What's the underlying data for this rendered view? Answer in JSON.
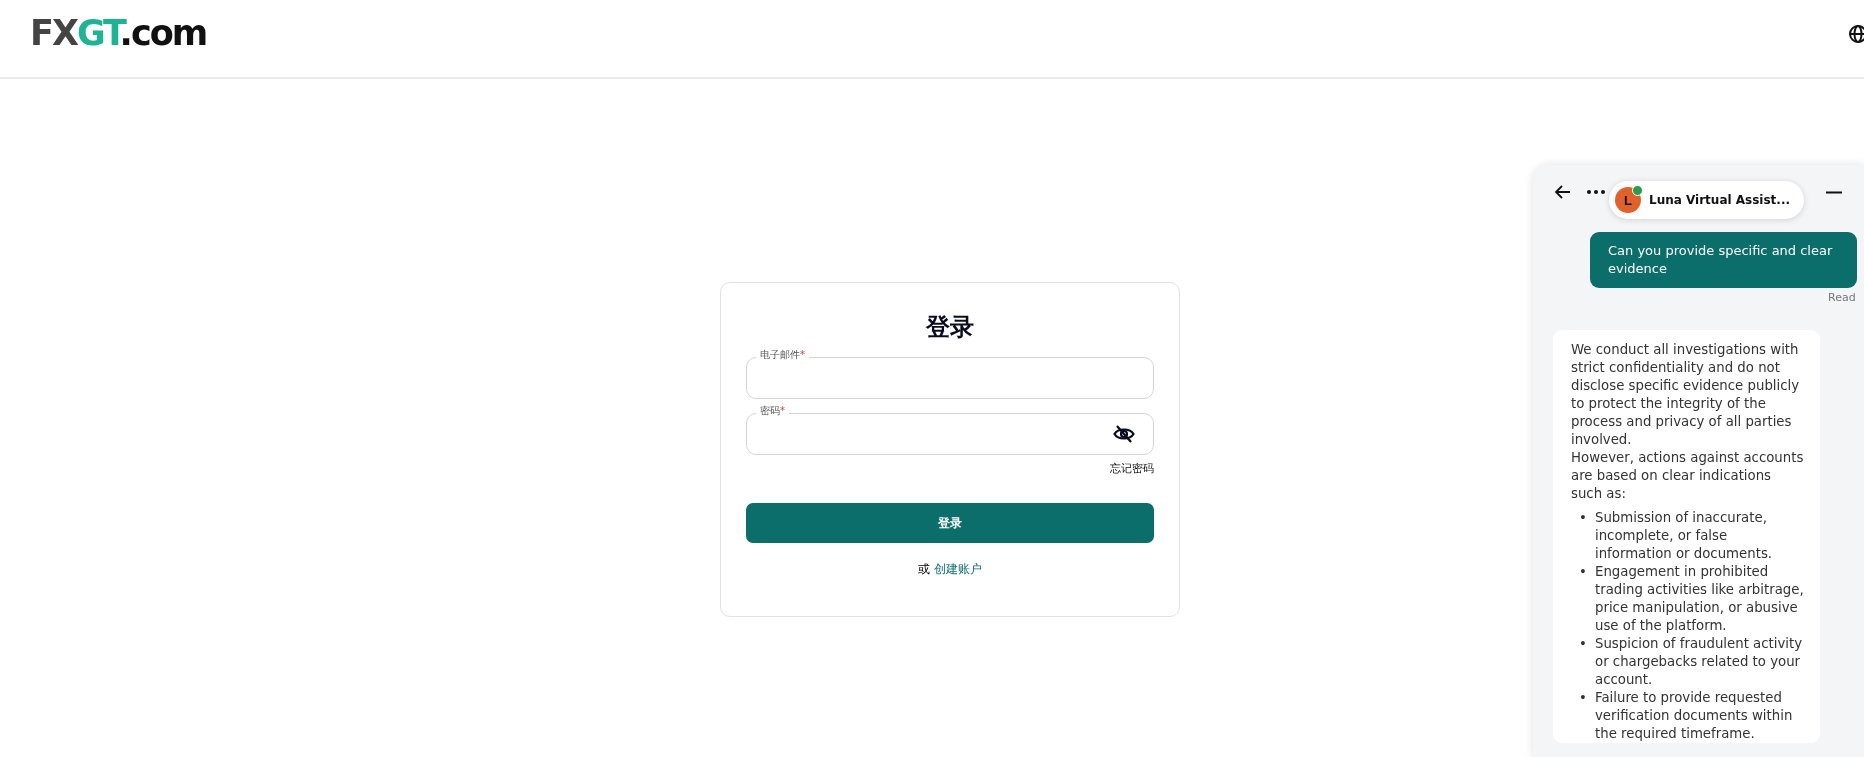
{
  "header": {
    "logo": {
      "prefix": "FX",
      "accent": "GT",
      "suffix": ".com"
    }
  },
  "login": {
    "title": "登录",
    "fields": [
      {
        "label": "电子邮件",
        "required_mark": "*",
        "kind": "text"
      },
      {
        "label": "密码",
        "required_mark": "*",
        "kind": "password"
      }
    ],
    "forgot_link": "忘记密码",
    "submit": "登录",
    "alt_prefix": "或",
    "alt_link": "创建账户"
  },
  "chat": {
    "agent": {
      "initial": "L",
      "name": "Luna Virtual Assist...",
      "online": true
    },
    "messages": [
      {
        "kind": "user",
        "text": "Can you provide specific and clear evidence",
        "status": "Read"
      },
      {
        "kind": "bot",
        "bullet_marker": "•",
        "paragraphs": [
          "We conduct all investigations with strict confidentiality and do not disclose specific evidence publicly to protect the integrity of the process and privacy of all parties involved.",
          "However, actions against accounts are based on clear indications such as:"
        ],
        "bullets": [
          "Submission of inaccurate, incomplete, or false information or documents.",
          "Engagement in prohibited trading activities like arbitrage, price manipulation, or abusive use of the platform.",
          "Suspicion of fraudulent activity or chargebacks related to your account.",
          "Failure to provide requested verification documents within the required timeframe."
        ]
      }
    ]
  }
}
